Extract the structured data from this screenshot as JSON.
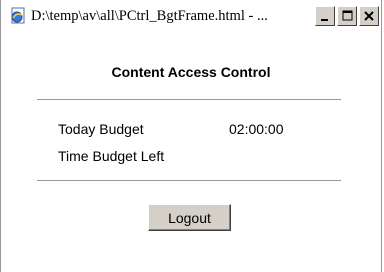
{
  "window": {
    "title": "D:\\temp\\av\\all\\PCtrl_BgtFrame.html - ..."
  },
  "page": {
    "heading": "Content Access Control",
    "rows": [
      {
        "label": "Today Budget",
        "value": "02:00:00"
      },
      {
        "label": "Time Budget Left",
        "value": ""
      }
    ],
    "logout_label": "Logout"
  },
  "colors": {
    "button_face": "#d4d0c8",
    "separator": "#999999"
  }
}
